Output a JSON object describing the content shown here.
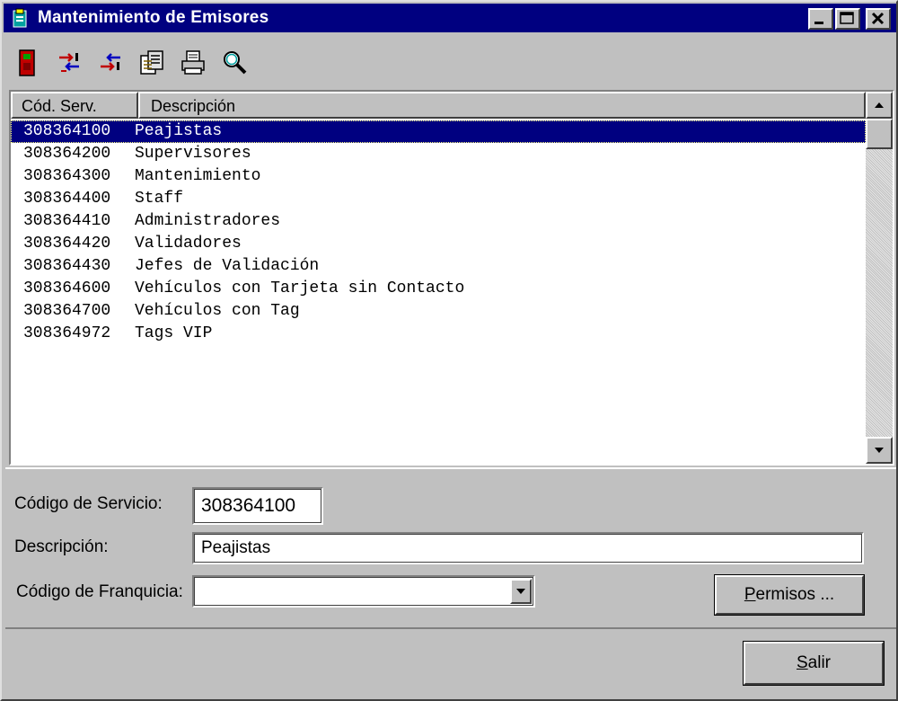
{
  "window": {
    "title": "Mantenimiento de Emisores"
  },
  "toolbar": {
    "icons": [
      "exit-door-icon",
      "add-record-icon",
      "remove-record-icon",
      "copy-icon",
      "print-icon",
      "search-icon"
    ]
  },
  "list": {
    "columns": [
      "Cód. Serv.",
      "Descripción"
    ],
    "rows": [
      {
        "code": "308364100",
        "desc": "Peajistas"
      },
      {
        "code": "308364200",
        "desc": "Supervisores"
      },
      {
        "code": "308364300",
        "desc": "Mantenimiento"
      },
      {
        "code": "308364400",
        "desc": "Staff"
      },
      {
        "code": "308364410",
        "desc": "Administradores"
      },
      {
        "code": "308364420",
        "desc": "Validadores"
      },
      {
        "code": "308364430",
        "desc": "Jefes de Validación"
      },
      {
        "code": "308364600",
        "desc": "Vehículos con Tarjeta sin Contacto"
      },
      {
        "code": "308364700",
        "desc": "Vehículos con Tag"
      },
      {
        "code": "308364972",
        "desc": "Tags VIP"
      }
    ],
    "selected_index": 0
  },
  "form": {
    "codigo_servicio_label": "Código de Servicio:",
    "codigo_servicio_value": "308364100",
    "descripcion_label": "Descripción:",
    "descripcion_value": "Peajistas",
    "franquicia_label": "Código de Franquicia:",
    "franquicia_value": "",
    "permisos_pre": "P",
    "permisos_rest": "ermisos ..."
  },
  "footer": {
    "salir_pre": "S",
    "salir_rest": "alir"
  },
  "colors": {
    "titlebar": "#000080",
    "face": "#c0c0c0",
    "selection": "#000080"
  }
}
